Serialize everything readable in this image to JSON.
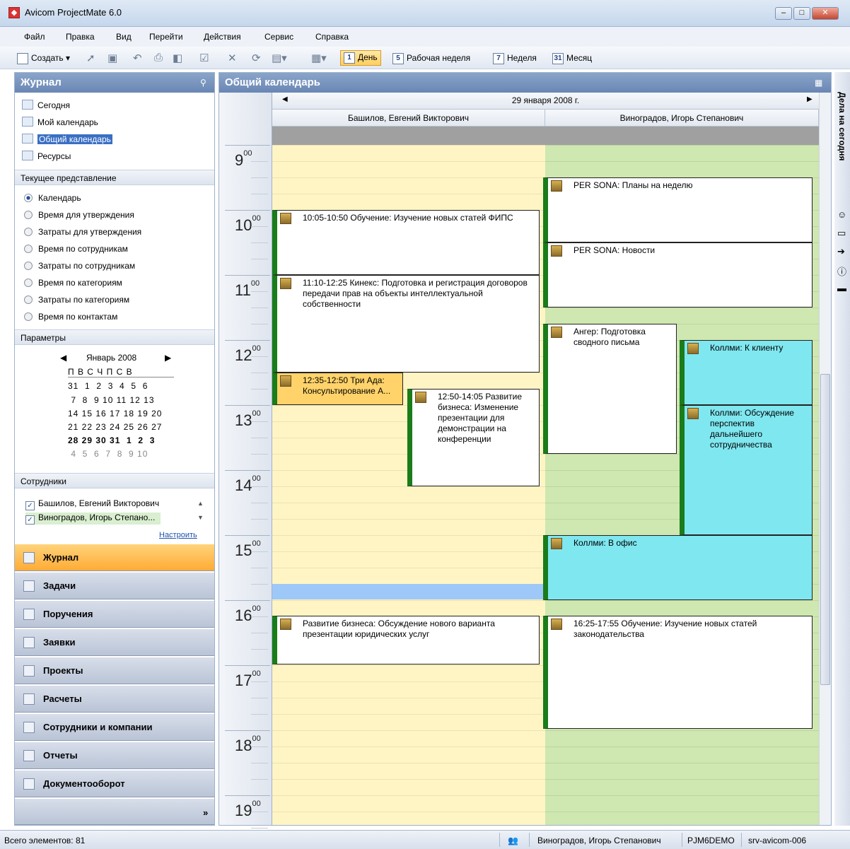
{
  "window": {
    "title": "Avicom ProjectMate 6.0",
    "min": "–",
    "max": "□",
    "close": "✕"
  },
  "menu": [
    "Файл",
    "Правка",
    "Вид",
    "Перейти",
    "Действия",
    "Сервис",
    "Справка"
  ],
  "toolbar": {
    "create": "Создать",
    "day": "День",
    "day_num": "1",
    "workweek": "Рабочая неделя",
    "workweek_num": "5",
    "week": "Неделя",
    "week_num": "7",
    "month": "Месяц",
    "month_num": "31"
  },
  "left": {
    "title": "Журнал",
    "nav": [
      "Сегодня",
      "Мой календарь",
      "Общий календарь",
      "Ресурсы"
    ],
    "current_view_label": "Текущее представление",
    "views": [
      "Календарь",
      "Время для утверждения",
      "Затраты для утверждения",
      "Время по сотрудникам",
      "Затраты по сотрудникам",
      "Время по категориям",
      "Затраты по категориям",
      "Время по контактам"
    ],
    "params_label": "Параметры",
    "minical": {
      "month": "Январь 2008",
      "weekdays": "П В С Ч П С В",
      "rows": [
        "31  1  2  3  4  5  6",
        " 7  8  9 10 11 12 13",
        "14 15 16 17 18 19 20",
        "21 22 23 24 25 26 27",
        "28 29 30 31  1  2  3",
        " 4  5  6  7  8  9 10"
      ]
    },
    "staff_label": "Сотрудники",
    "staff": [
      "Башилов, Евгений Викторович",
      "Виноградов, Игорь Степано..."
    ],
    "configure": "Настроить",
    "buttons": [
      "Журнал",
      "Задачи",
      "Поручения",
      "Заявки",
      "Проекты",
      "Расчеты",
      "Сотрудники и компании",
      "Отчеты",
      "Документооборот"
    ]
  },
  "calendar": {
    "title": "Общий календарь",
    "date": "29 января 2008 г.",
    "people": [
      "Башилов, Евгений Викторович",
      "Виноградов, Игорь Степанович"
    ],
    "hours": [
      "9",
      "10",
      "11",
      "12",
      "13",
      "14",
      "15",
      "16",
      "17",
      "18",
      "19"
    ],
    "minutes_label": "00",
    "appointments": [
      "10:05-10:50 Обучение:  Изучение новых статей ФИПС",
      "11:10-12:25 Кинекс:  Подготовка и регистрация договоров передачи прав на объекты интеллектуальной собственности",
      "12:35-12:50 Три Ада: Консультирование А...",
      "12:50-14:05 Развитие бизнеса:  Изменение презентации для демонстрации на конференции",
      "Развитие бизнеса:  Обсуждение нового варианта презентации юридических услуг",
      "PER SONA:  Планы на неделю",
      "PER SONA:  Новости",
      "Ангер:  Подготовка сводного письма",
      "Коллми:  К клиенту",
      "Коллми:  Обсуждение перспектив дальнейшего сотрудничества",
      "Коллми:  В офис",
      "16:25-17:55 Обучение:  Изучение новых статей законодательства"
    ]
  },
  "right_panel": "Дела на сегодня",
  "status": {
    "count": "Всего элементов: 81",
    "user": "Виноградов, Игорь Степанович",
    "db": "PJM6DEMO",
    "server": "srv-avicom-006"
  },
  "colors": {
    "accent": "#6986b4",
    "selected": "#ffab35",
    "col1": "#fff5c4",
    "col2": "#cfe7b0",
    "appt_cyan": "#7fe7f0"
  }
}
